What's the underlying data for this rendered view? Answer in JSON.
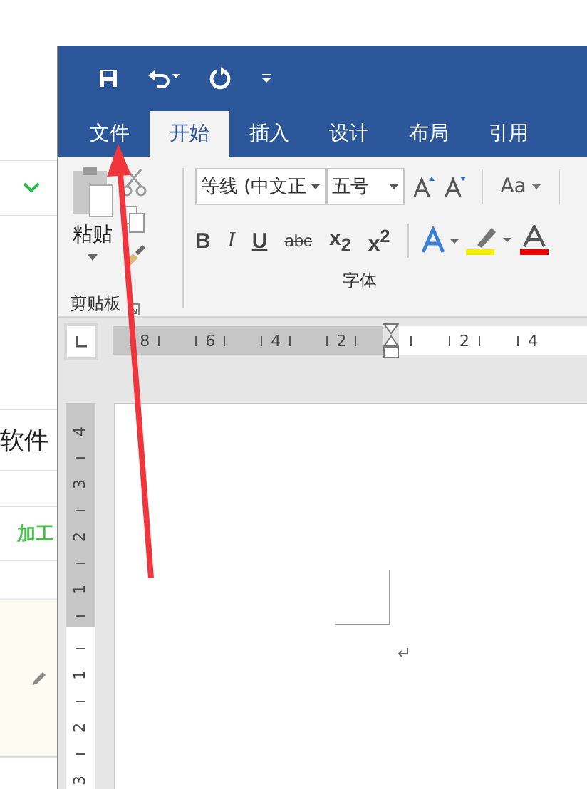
{
  "tabs": [
    {
      "label": "文件",
      "selected": false
    },
    {
      "label": "开始",
      "selected": true
    },
    {
      "label": "插入",
      "selected": false
    },
    {
      "label": "设计",
      "selected": false
    },
    {
      "label": "布局",
      "selected": false
    },
    {
      "label": "引用",
      "selected": false
    }
  ],
  "clipboard": {
    "paste_label": "粘贴",
    "group_label": "剪贴板"
  },
  "font": {
    "font_name": "等线 (中文正",
    "font_size": "五号",
    "case_label": "Aa",
    "group_label": "字体",
    "format_buttons": [
      {
        "label": "B",
        "kind": "bold"
      },
      {
        "label": "I",
        "kind": "italic"
      },
      {
        "label": "U",
        "kind": "underline"
      },
      {
        "label": "abc",
        "kind": "strike"
      },
      {
        "label": "x$_{2}$",
        "kind": "script"
      },
      {
        "label": "x$^{2}$",
        "kind": "script"
      }
    ]
  },
  "ruler": {
    "left_marks": [
      "8",
      "6",
      "4",
      "2"
    ],
    "right_marks": [
      "2",
      "4"
    ]
  },
  "vertical_ruler": {
    "upper_marks": [
      "4",
      "3",
      "2",
      "1"
    ],
    "lower_marks": [
      "1",
      "2",
      "3"
    ]
  },
  "background_page": {
    "texts": [
      "软件",
      "加工"
    ]
  }
}
